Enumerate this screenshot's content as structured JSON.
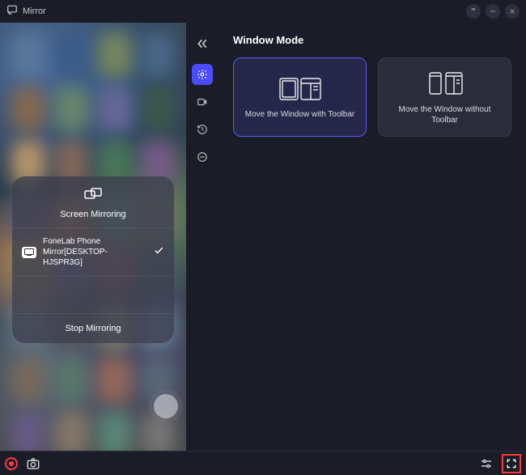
{
  "titlebar": {
    "app_name": "Mirror"
  },
  "mirror_popup": {
    "title": "Screen Mirroring",
    "device_line1": "FoneLab Phone",
    "device_line2": "Mirror[DESKTOP-HJSPR3G]",
    "stop_label": "Stop Mirroring"
  },
  "section": {
    "title": "Window Mode"
  },
  "cards": [
    {
      "label": "Move the Window with Toolbar",
      "selected": true
    },
    {
      "label": "Move the Window without Toolbar",
      "selected": false
    }
  ]
}
